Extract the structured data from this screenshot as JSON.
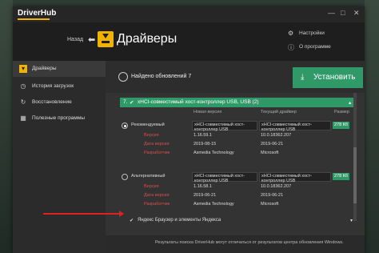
{
  "app": {
    "title": "DriverHub"
  },
  "window_controls": {
    "minimize": "—",
    "maximize": "□",
    "close": "✕"
  },
  "header": {
    "back_label": "Назад",
    "back_arrow": "⬅",
    "page_title": "Драйверы",
    "settings_label": "Настройки",
    "about_label": "О программе"
  },
  "sidebar": {
    "items": [
      {
        "label": "Драйверы",
        "icon": "driver-icon"
      },
      {
        "label": "История загрузок",
        "icon": "history-icon"
      },
      {
        "label": "Восстановление",
        "icon": "restore-icon"
      },
      {
        "label": "Полезные программы",
        "icon": "apps-icon"
      }
    ]
  },
  "main": {
    "updates_found": "Найдено обновлений 7",
    "install_label": "Установить",
    "group": {
      "number": "7.",
      "title": "xHCI-совместимый хост-контроллер USB, USB (2)"
    },
    "columns": {
      "new_version": "Новая версия",
      "current_driver": "Текущий драйвер",
      "size": "Размер"
    },
    "recommended": {
      "label": "Рекомендуемый",
      "name": "xHCI-совместимый хост-контроллер USB",
      "current_name": "xHCI-совместимый хост-контроллер USB",
      "size": "278 Кб",
      "version_label": "Версия",
      "version": "1.16.59.1",
      "current_version": "10.0.18362.207",
      "date_label": "Дата версии",
      "date": "2019-08-15",
      "current_date": "2019-06-21",
      "dev_label": "Разработчик",
      "dev": "Asmedia Technology",
      "current_dev": "Microsoft"
    },
    "alternative": {
      "label": "Альтернативный",
      "name": "xHCI-совместимый хост-контроллер USB",
      "current_name": "xHCI-совместимый хост-контроллер USB",
      "size": "278 Кб",
      "version_label": "Версия",
      "version": "1.16.58.1",
      "current_version": "10.0.18362.207",
      "date_label": "Дата версии",
      "date": "2019-06-21",
      "current_date": "2019-06-21",
      "dev_label": "Разработчик",
      "dev": "Asmedia Technology",
      "current_dev": "Microsoft"
    },
    "yandex": {
      "label": "Яндекс Браузер и элементы Яндекса",
      "checkmark": "✔",
      "chevron": "▾"
    },
    "footer": "Результаты поиска DriverHub могут отличаться от результатов центра обновления Windows."
  },
  "colors": {
    "accent_green": "#2f9a68",
    "accent_yellow": "#f0b400",
    "red_text": "#d45050",
    "annotation_arrow": "#e02020"
  }
}
